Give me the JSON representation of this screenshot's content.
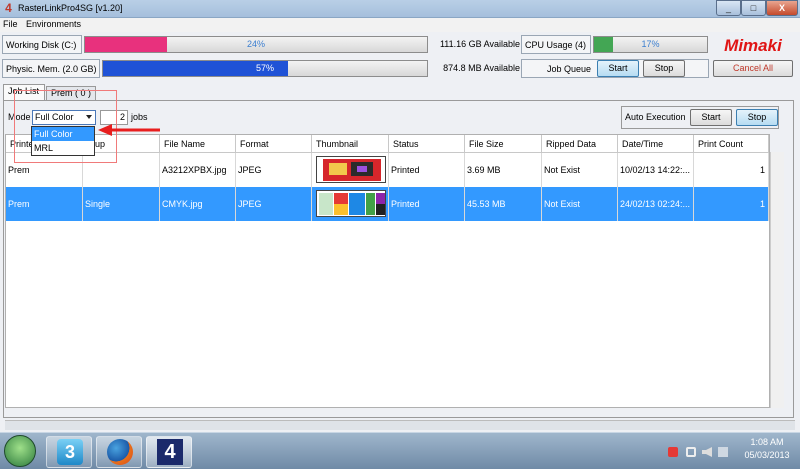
{
  "window": {
    "title": "RasterLinkPro4SG  [v1.20]",
    "app_icon": "4",
    "controls": [
      "_",
      "□",
      "X"
    ]
  },
  "menu": {
    "file": "File",
    "environments": "Environments"
  },
  "status": {
    "working_disk": {
      "label": "Working Disk (C:)",
      "percent_text": "24%",
      "percent": 24,
      "available": "111.16 GB Available",
      "color": "#e8317d"
    },
    "phys_mem": {
      "label": "Physic. Mem. (2.0 GB)",
      "percent_text": "57%",
      "percent": 57,
      "available": "874.8 MB Available",
      "color": "#1f52d6"
    },
    "cpu": {
      "label": "CPU Usage (4)",
      "percent_text": "17%",
      "percent": 17,
      "color": "#43a654"
    },
    "job_queue": {
      "label": "Job Queue",
      "start": "Start",
      "stop": "Stop"
    },
    "cancel_all": "Cancel All",
    "logo": "Mimaki"
  },
  "tabs": [
    {
      "label": "Job List"
    },
    {
      "label": "Prem ( 0 )"
    }
  ],
  "mode": {
    "label": "Mode",
    "value": "Full Color",
    "options": [
      "Full Color",
      "MRL"
    ],
    "jobs_count": "2",
    "jobs_label": "jobs"
  },
  "auto_execution": {
    "label": "Auto Execution",
    "start": "Start",
    "stop": "Stop"
  },
  "table": {
    "columns": [
      "Printe",
      "roup",
      "File Name",
      "Format",
      "Thumbnail",
      "Status",
      "File Size",
      "Ripped Data",
      "Date/Time",
      "Print Count"
    ],
    "rows": [
      {
        "printer": "Prem",
        "group": "",
        "file_name": "A3212XPBX.jpg",
        "format": "JPEG",
        "status": "Printed",
        "file_size": "3.69 MB",
        "ripped": "Not Exist",
        "datetime": "10/02/13 14:22:...",
        "count": "1",
        "selected": false
      },
      {
        "printer": "Prem",
        "group": "Single",
        "file_name": "CMYK.jpg",
        "format": "JPEG",
        "status": "Printed",
        "file_size": "45.53 MB",
        "ripped": "Not Exist",
        "datetime": "24/02/13 02:24:...",
        "count": "1",
        "selected": true
      }
    ]
  },
  "taskbar": {
    "time": "1:08 AM",
    "date": "05/03/2013",
    "pinned": [
      "app-3-icon",
      "firefox-icon",
      "rasterlink-icon"
    ],
    "pinned_labels": [
      "3",
      "4"
    ]
  }
}
